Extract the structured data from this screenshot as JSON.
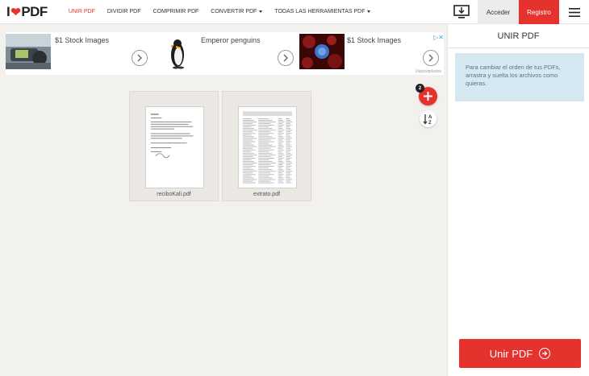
{
  "logo": {
    "prefix": "I",
    "suffix": "PDF"
  },
  "nav": {
    "items": [
      {
        "label": "UNIR PDF",
        "active": true
      },
      {
        "label": "DIVIDIR PDF",
        "active": false
      },
      {
        "label": "COMPRIMIR PDF",
        "active": false
      },
      {
        "label": "CONVERTIR PDF",
        "active": false,
        "dropdown": true
      },
      {
        "label": "TODAS LAS HERRAMIENTAS PDF",
        "active": false,
        "dropdown": true
      }
    ]
  },
  "header": {
    "login_label": "Acceder",
    "register_label": "Registro",
    "desktop_icon": "desktop-download-icon",
    "menu_icon": "hamburger-menu-icon"
  },
  "ads": {
    "items": [
      {
        "title": "$1 Stock Images"
      },
      {
        "title": "Emperor penguins"
      },
      {
        "title": "$1 Stock Images"
      }
    ],
    "source": "Depositphotos"
  },
  "files": [
    {
      "name": "reciboKali.pdf"
    },
    {
      "name": "extrato.pdf"
    }
  ],
  "add_button": {
    "badge_count": "2"
  },
  "sidebar": {
    "title": "UNIR PDF",
    "info": "Para cambiar el orden de tus PDFs, arrastra y sueltа los archivos como quieras.",
    "merge_label": "Unir PDF"
  },
  "colors": {
    "brand": "#e5322d",
    "info_bg": "#d6e9f3"
  }
}
